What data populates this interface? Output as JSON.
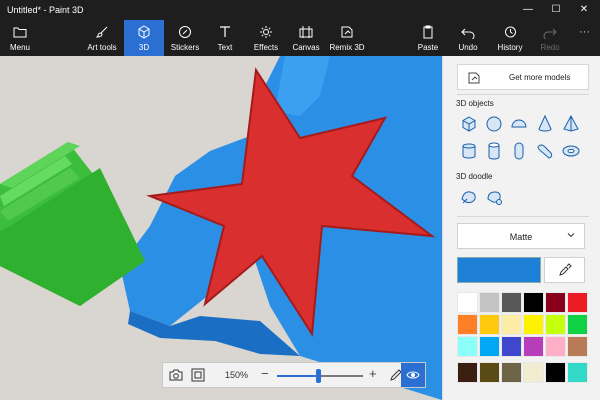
{
  "window": {
    "title": "Untitled* - Paint 3D"
  },
  "window_controls": {
    "minimize": "—",
    "maximize": "☐",
    "close": "✕"
  },
  "toolbar": {
    "items": [
      {
        "label": "Menu",
        "icon": "folder-icon"
      },
      {
        "label": "Art tools",
        "icon": "brush-icon"
      },
      {
        "label": "3D",
        "icon": "cube-icon",
        "active": true
      },
      {
        "label": "Stickers",
        "icon": "sticker-icon"
      },
      {
        "label": "Text",
        "icon": "text-icon"
      },
      {
        "label": "Effects",
        "icon": "sun-icon"
      },
      {
        "label": "Canvas",
        "icon": "canvas-icon"
      },
      {
        "label": "Remix 3D",
        "icon": "remix-icon"
      },
      {
        "label": "Paste",
        "icon": "paste-icon"
      },
      {
        "label": "Undo",
        "icon": "undo-icon"
      },
      {
        "label": "History",
        "icon": "history-icon"
      },
      {
        "label": "Redo",
        "icon": "redo-icon",
        "disabled": true
      }
    ],
    "more": "···"
  },
  "panel": {
    "get_models": "Get more models",
    "objects_heading": "3D objects",
    "objects": [
      "cube",
      "sphere",
      "hemisphere",
      "cone",
      "pyramid",
      "cylinder",
      "tube",
      "capsule",
      "curved-cylinder",
      "donut"
    ],
    "doodle_heading": "3D doodle",
    "doodles": [
      "sharp-edge-doodle",
      "soft-edge-doodle"
    ],
    "finish": "Matte",
    "selected_color": "#1e7fd6",
    "palette": [
      [
        "#ffffff",
        "#c3c3c3",
        "#585858",
        "#000000",
        "#88001b",
        "#ec1c24"
      ],
      [
        "#ff7f27",
        "#ffc90e",
        "#fdeca6",
        "#fff200",
        "#c4ff0e",
        "#0ed145"
      ],
      [
        "#8cfffb",
        "#00a8f3",
        "#3f48cc",
        "#b83dba",
        "#ffaec8",
        "#b97a56"
      ]
    ],
    "custom_colors": [
      "#3b1f12",
      "#5a4a14",
      "#6d6346",
      "#f2ecd0",
      "#000000",
      "#32d8c8"
    ]
  },
  "zoom": {
    "value": "150%",
    "minus": "−",
    "plus": "+",
    "level": 0.48
  }
}
